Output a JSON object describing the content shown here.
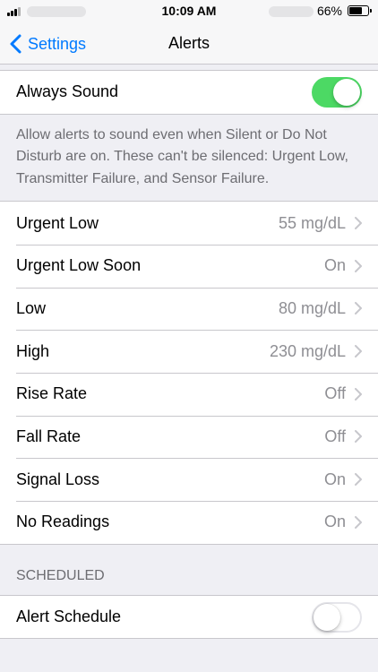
{
  "status_bar": {
    "time": "10:09 AM",
    "battery_percent": "66%",
    "battery_level": 0.66
  },
  "nav": {
    "back_label": "Settings",
    "title": "Alerts"
  },
  "always_sound": {
    "label": "Always Sound",
    "enabled": true,
    "footer": "Allow alerts to sound even when Silent or Do Not Disturb are on. These can't be silenced: Urgent Low, Transmitter Failure, and Sensor Failure."
  },
  "alerts": [
    {
      "label": "Urgent Low",
      "value": "55 mg/dL"
    },
    {
      "label": "Urgent Low Soon",
      "value": "On"
    },
    {
      "label": "Low",
      "value": "80 mg/dL"
    },
    {
      "label": "High",
      "value": "230 mg/dL"
    },
    {
      "label": "Rise Rate",
      "value": "Off"
    },
    {
      "label": "Fall Rate",
      "value": "Off"
    },
    {
      "label": "Signal Loss",
      "value": "On"
    },
    {
      "label": "No Readings",
      "value": "On"
    }
  ],
  "scheduled": {
    "header": "SCHEDULED",
    "alert_schedule_label": "Alert Schedule",
    "enabled": false
  },
  "colors": {
    "accent": "#007aff",
    "toggle_on": "#4cd964",
    "secondary_text": "#8e8e93",
    "background": "#efeff4"
  }
}
